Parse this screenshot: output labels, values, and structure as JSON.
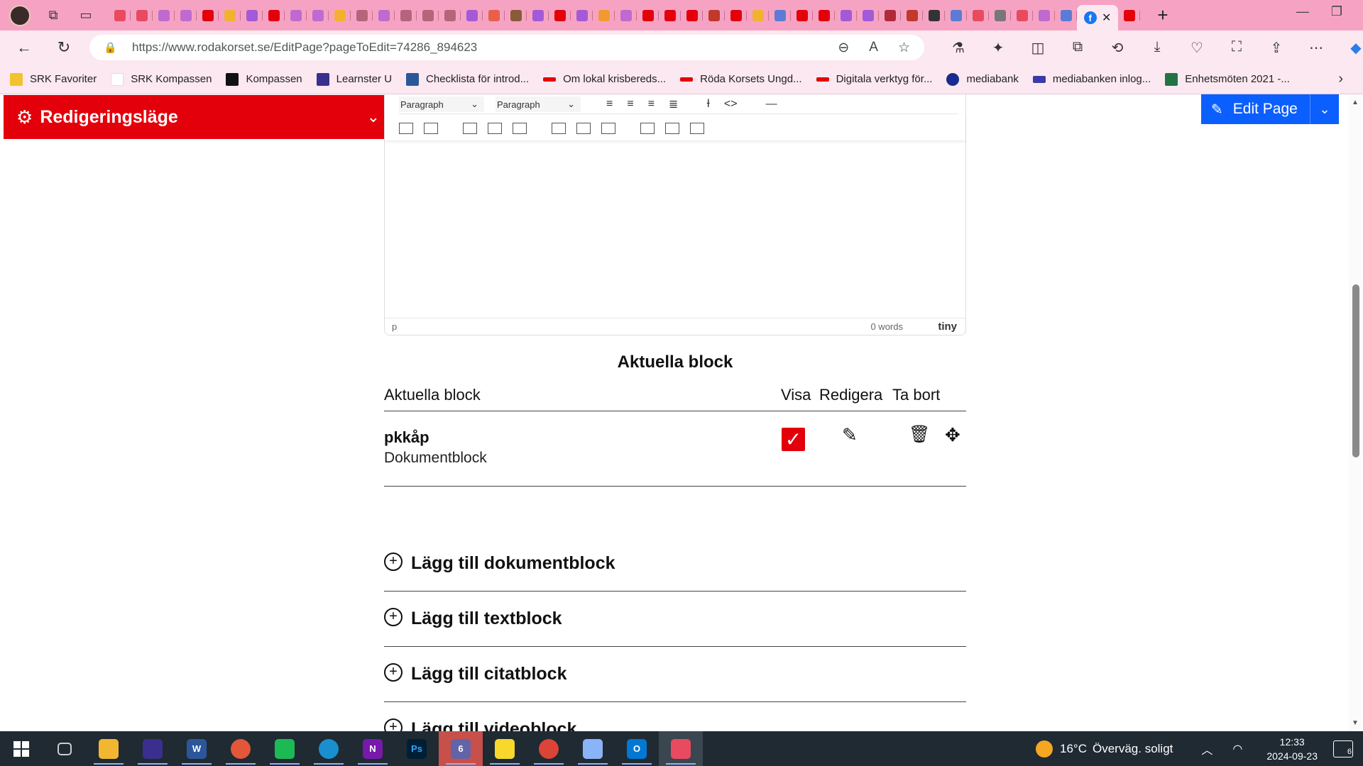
{
  "browser": {
    "url": "https://www.rodakorset.se/EditPage?pageToEdit=74286_894623",
    "active_tab_icon": "facebook-icon",
    "bookmarks": [
      {
        "label": "SRK Favoriter",
        "icon": "folder-icon",
        "color": "#f2c230"
      },
      {
        "label": "SRK Kompassen",
        "icon": "page-icon",
        "color": "#ffffff"
      },
      {
        "label": "Kompassen",
        "icon": "plus-square-icon",
        "color": "#111111"
      },
      {
        "label": "Learnster U",
        "icon": "learnster-icon",
        "color": "#3a2f8f"
      },
      {
        "label": "Checklista för introd...",
        "icon": "word-icon",
        "color": "#2b579a"
      },
      {
        "label": "Om lokal krisbereds...",
        "icon": "redcross-icon",
        "color": "#e3000b"
      },
      {
        "label": "Röda Korsets Ungd...",
        "icon": "redcross-icon",
        "color": "#e3000b"
      },
      {
        "label": "Digitala verktyg för...",
        "icon": "redcross-icon",
        "color": "#e3000b"
      },
      {
        "label": "mediabank",
        "icon": "circle-icon",
        "color": "#1a2b8f"
      },
      {
        "label": "mediabanken inlog...",
        "icon": "link-icon",
        "color": "#3b3aa8"
      },
      {
        "label": "Enhetsmöten 2021 -...",
        "icon": "excel-icon",
        "color": "#217346"
      }
    ]
  },
  "editmode": {
    "title": "Redigeringsläge"
  },
  "edit_page_button": {
    "label": "Edit Page"
  },
  "editor": {
    "format_select_1": "Paragraph",
    "format_select_2": "Paragraph",
    "path": "p",
    "word_count": "0 words",
    "brand": "tiny"
  },
  "blocks": {
    "heading": "Aktuella block",
    "columns": {
      "name": "Aktuella block",
      "show": "Visa",
      "edit": "Redigera",
      "delete": "Ta bort"
    },
    "rows": [
      {
        "name": "pkkåp",
        "type": "Dokumentblock",
        "visible": true
      }
    ]
  },
  "add_actions": [
    "Lägg till dokumentblock",
    "Lägg till textblock",
    "Lägg till citatblock",
    "Lägg till videoblock"
  ],
  "taskbar": {
    "teams_badge": "6",
    "weather_temp": "16°C",
    "weather_text": "Överväg. soligt",
    "time": "12:33",
    "date": "2024-09-23",
    "notifications": "6"
  }
}
